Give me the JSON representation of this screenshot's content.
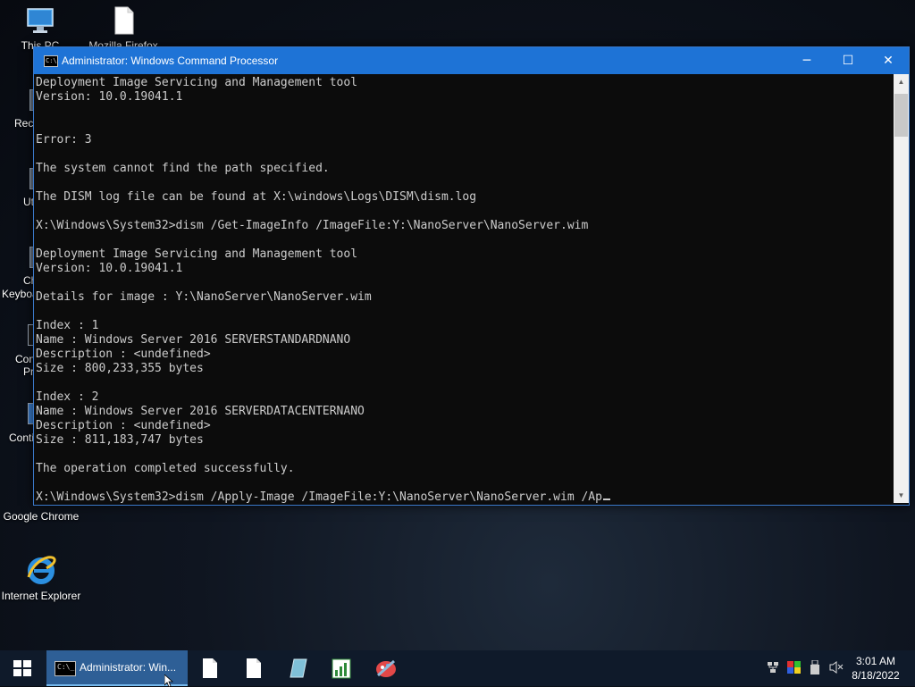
{
  "desktop": {
    "icons": [
      {
        "label": "This PC"
      },
      {
        "label": "Mozilla Firefox"
      },
      {
        "label": "Google Chrome"
      },
      {
        "label": "Internet Explorer"
      }
    ],
    "partial_labels": [
      "Recy",
      "Uti",
      "Ch",
      "Keyboa",
      "Con",
      "Pr",
      "Conti"
    ]
  },
  "window": {
    "title": "Administrator: Windows Command Processor",
    "controls": {
      "minimize": "─",
      "maximize": "☐",
      "close": "✕"
    },
    "console_lines": [
      "Deployment Image Servicing and Management tool",
      "Version: 10.0.19041.1",
      "",
      "",
      "Error: 3",
      "",
      "The system cannot find the path specified.",
      "",
      "The DISM log file can be found at X:\\windows\\Logs\\DISM\\dism.log",
      "",
      "X:\\Windows\\System32>dism /Get-ImageInfo /ImageFile:Y:\\NanoServer\\NanoServer.wim",
      "",
      "Deployment Image Servicing and Management tool",
      "Version: 10.0.19041.1",
      "",
      "Details for image : Y:\\NanoServer\\NanoServer.wim",
      "",
      "Index : 1",
      "Name : Windows Server 2016 SERVERSTANDARDNANO",
      "Description : <undefined>",
      "Size : 800,233,355 bytes",
      "",
      "Index : 2",
      "Name : Windows Server 2016 SERVERDATACENTERNANO",
      "Description : <undefined>",
      "Size : 811,183,747 bytes",
      "",
      "The operation completed successfully.",
      "",
      "X:\\Windows\\System32>dism /Apply-Image /ImageFile:Y:\\NanoServer\\NanoServer.wim /Ap"
    ]
  },
  "taskbar": {
    "active_task_label": "Administrator: Win...",
    "pinned_icons": [
      "notepad-icon",
      "file-icon",
      "disk-tool-icon",
      "spreadsheet-icon",
      "paint-icon"
    ],
    "tray_icons": [
      "network-icon",
      "color-icon",
      "usb-icon",
      "volume-muted-icon"
    ],
    "clock": {
      "time": "3:01 AM",
      "date": "8/18/2022"
    }
  },
  "colors": {
    "titlebar": "#1e73d6",
    "console_bg": "#0c0c0c",
    "console_text": "#cccccc",
    "taskbar_bg": "#0f1a2a",
    "active_task": "#2e5f96"
  }
}
